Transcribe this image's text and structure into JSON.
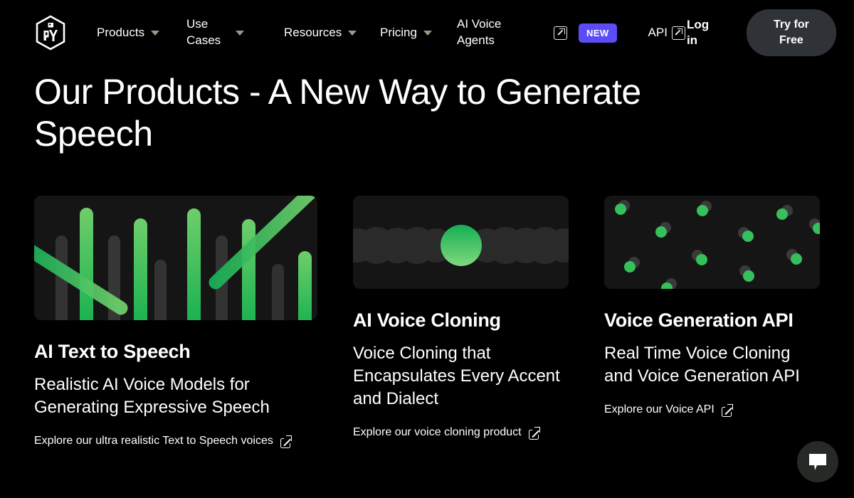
{
  "nav": {
    "logo_name": "play-ht-cube-logo",
    "items": [
      {
        "label": "Products",
        "has_caret": true,
        "name": "nav-products"
      },
      {
        "label": "Use Cases",
        "has_caret": true,
        "name": "nav-use-cases"
      },
      {
        "label": "Resources",
        "has_caret": true,
        "name": "nav-resources"
      },
      {
        "label": "Pricing",
        "has_caret": true,
        "name": "nav-pricing"
      },
      {
        "label": "AI Voice Agents",
        "has_caret": false,
        "name": "nav-ai-voice-agents"
      },
      {
        "label": "API",
        "has_caret": false,
        "name": "nav-api"
      }
    ],
    "new_badge": "NEW",
    "new_badge_color": "#5b4cf5",
    "login_label": "Log in",
    "cta_label": "Try for Free",
    "cta_bg": "#2f3338",
    "caret_color": "#9a9a82"
  },
  "hero": {
    "title": "Our Products - A New Way to Generate Speech"
  },
  "cards": [
    {
      "title": "AI Text to Speech",
      "description": "Realistic AI Voice Models for Generating Expressive Speech",
      "link_label": "Explore our ultra realistic Text to Speech voices",
      "media_name": "bar-waveform-graphic"
    },
    {
      "title": "AI Voice Cloning",
      "description": "Voice Cloning that Encapsulates Every Accent and Dialect",
      "link_label": "Explore our voice cloning product",
      "media_name": "overlapping-circles-graphic"
    },
    {
      "title": "Voice Generation API",
      "description": "Real Time Voice Cloning and Voice Generation API",
      "link_label": "Explore our Voice API",
      "media_name": "scattered-dots-graphic"
    }
  ],
  "chat": {
    "icon": "chat-bubble-icon",
    "bg": "#252a27"
  },
  "theme": {
    "page_bg": "#000000",
    "card_media_bg": "#151515",
    "accent_green_light": "#64d16a",
    "accent_green_dark": "#1fae4e",
    "muted_bar": "#333333"
  }
}
